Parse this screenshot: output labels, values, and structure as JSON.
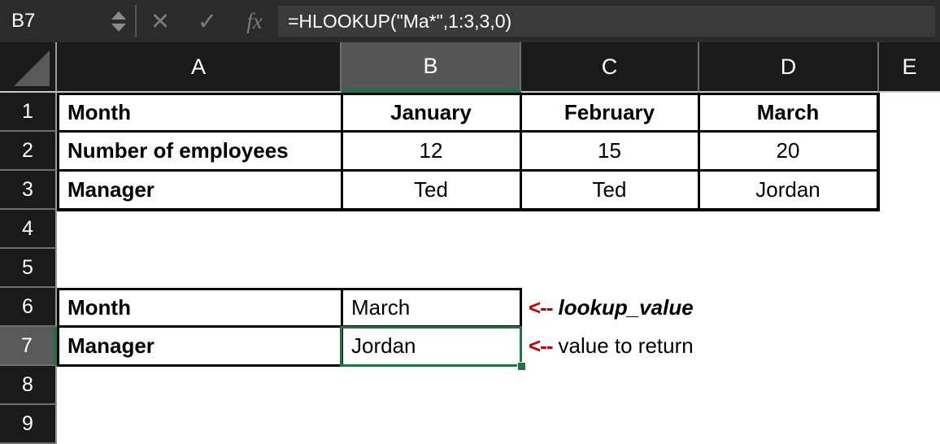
{
  "formula_bar": {
    "name_box_value": "B7",
    "cancel_icon": "✕",
    "enter_icon": "✓",
    "fx_icon": "fx",
    "formula_value": "=HLOOKUP(\"Ma*\",1:3,3,0)"
  },
  "grid": {
    "columns": [
      {
        "id": "A",
        "label": "A",
        "active": false
      },
      {
        "id": "B",
        "label": "B",
        "active": true
      },
      {
        "id": "C",
        "label": "C",
        "active": false
      },
      {
        "id": "D",
        "label": "D",
        "active": false
      },
      {
        "id": "E",
        "label": "E",
        "active": false
      }
    ],
    "rows": [
      {
        "num": "1",
        "active": false
      },
      {
        "num": "2",
        "active": false
      },
      {
        "num": "3",
        "active": false
      },
      {
        "num": "4",
        "active": false
      },
      {
        "num": "5",
        "active": false
      },
      {
        "num": "6",
        "active": false
      },
      {
        "num": "7",
        "active": true
      },
      {
        "num": "8",
        "active": false
      },
      {
        "num": "9",
        "active": false
      }
    ],
    "cells": {
      "A1": "Month",
      "B1": "January",
      "C1": "February",
      "D1": "March",
      "A2": "Number of employees",
      "B2": "12",
      "C2": "15",
      "D2": "20",
      "A3": "Manager",
      "B3": "Ted",
      "C3": "Ted",
      "D3": "Jordan",
      "A6": "Month",
      "B6": "March",
      "A7": "Manager",
      "B7": "Jordan"
    },
    "selected_cell": "B7"
  },
  "annotations": {
    "arrow": "<--",
    "lookup_value_label": "lookup_value",
    "return_value_label": "value to return"
  },
  "colors": {
    "selection_green": "#217346",
    "annotation_red": "#c00000",
    "header_dark": "#1a1a1a",
    "formula_bar_dark": "#2b2b2b"
  }
}
